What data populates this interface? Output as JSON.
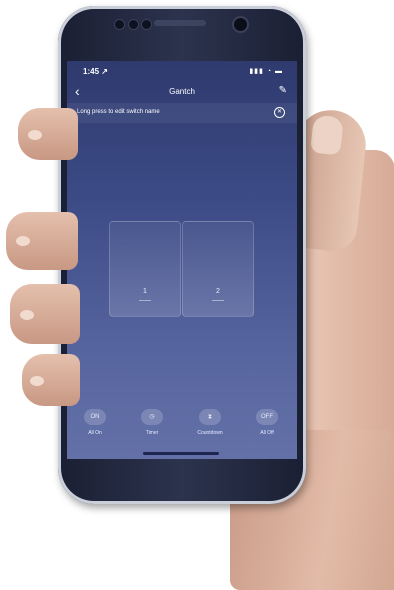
{
  "status": {
    "time": "1:45 ↗",
    "signal": "▮▮▮ ◔ ▬"
  },
  "header": {
    "title": "Gantch",
    "back_icon": "chevron-left-icon",
    "edit_icon": "pencil-icon"
  },
  "banner": {
    "text": "Long press to edit switch name",
    "close_icon": "close-circle-icon"
  },
  "switches": [
    {
      "label": "1"
    },
    {
      "label": "2"
    }
  ],
  "actions": [
    {
      "icon_text": "ON",
      "label": "All On"
    },
    {
      "icon_text": "◷",
      "label": "Timer"
    },
    {
      "icon_text": "⧗",
      "label": "Countdown"
    },
    {
      "icon_text": "OFF",
      "label": "All Off"
    }
  ],
  "colors": {
    "screen_top": "#2f3a6e",
    "screen_bottom": "#6471a8",
    "phone_body": "#1a1f33"
  }
}
